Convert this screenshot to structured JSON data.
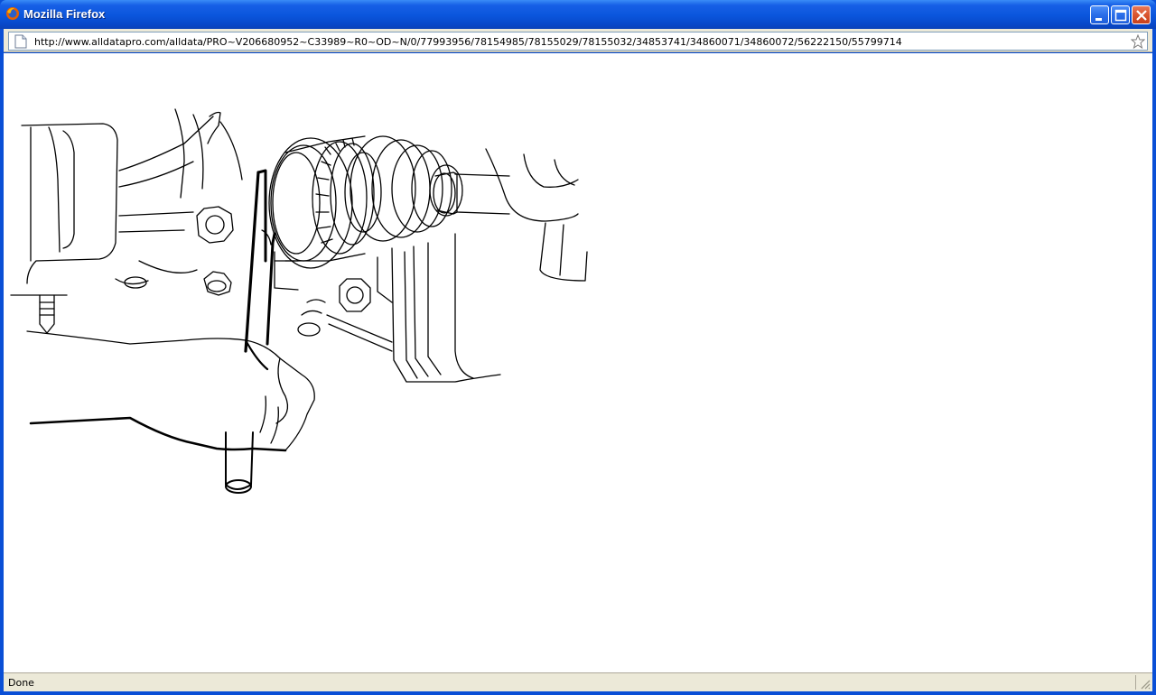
{
  "window": {
    "title": "Mozilla Firefox",
    "app_icon": "firefox-icon",
    "controls": [
      "minimize-icon",
      "maximize-icon",
      "close-icon"
    ]
  },
  "navigation": {
    "url": "http://www.alldatapro.com/alldata/PRO~V206680952~C33989~R0~OD~N/0/77993956/78154985/78155029/78155032/34853741/34860071/34860072/56222150/55799714",
    "page_icon": "page-icon",
    "bookmark_icon": "star-icon"
  },
  "status": {
    "text": "Done"
  },
  "colors": {
    "titlebar": "#0a55dc",
    "chrome": "#ece9d8",
    "close_button": "#d9552f"
  }
}
